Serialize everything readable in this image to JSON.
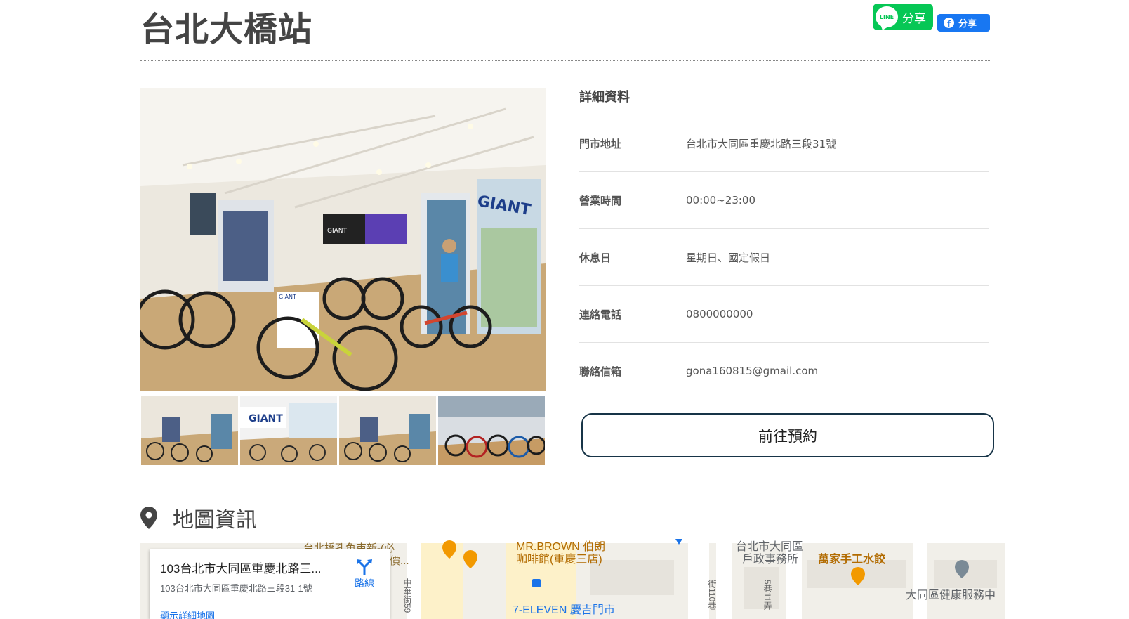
{
  "page": {
    "title": "台北大橋站"
  },
  "share": {
    "line_badge": "LINE",
    "line_label": "分享",
    "fb_glyph": "f",
    "fb_label": "分享"
  },
  "details": {
    "title": "詳細資料",
    "rows": [
      {
        "label": "門市地址",
        "value": "台北市大同區重慶北路三段31號"
      },
      {
        "label": "營業時間",
        "value": "00:00~23:00"
      },
      {
        "label": "休息日",
        "value": "星期日、國定假日"
      },
      {
        "label": "連絡電話",
        "value": "0800000000"
      },
      {
        "label": "聯絡信箱",
        "value": "gona160815@gmail.com"
      }
    ]
  },
  "reserve_button": "前往預約",
  "map_section": {
    "title": "地圖資訊",
    "card": {
      "title": "103台北市大同區重慶北路三...",
      "address": "103台北市大同區重慶北路三段31-1號",
      "route_label": "路線",
      "detail_link": "顯示詳細地圖"
    },
    "labels": {
      "bridge": "台北橋孔魚束新-(必",
      "price": "-價...",
      "mrbrown_1": "MR.BROWN 伯朗",
      "mrbrown_2": "咖啡館(重慶三店)",
      "seven": "7-ELEVEN 慶吉門市",
      "office_1": "台北市大同區",
      "office_2": "戶政事務所",
      "dumpling": "萬家手工水餃",
      "health": "大同區健康服務中",
      "street_a": "中華街59",
      "street_b": "街110巷",
      "street_c": "5巷11弄"
    }
  },
  "colors": {
    "line_green": "#06c755",
    "fb_blue": "#1877f2",
    "button_border": "#173447",
    "map_bg": "#f1efe9",
    "poi_orange": "#f29900"
  }
}
